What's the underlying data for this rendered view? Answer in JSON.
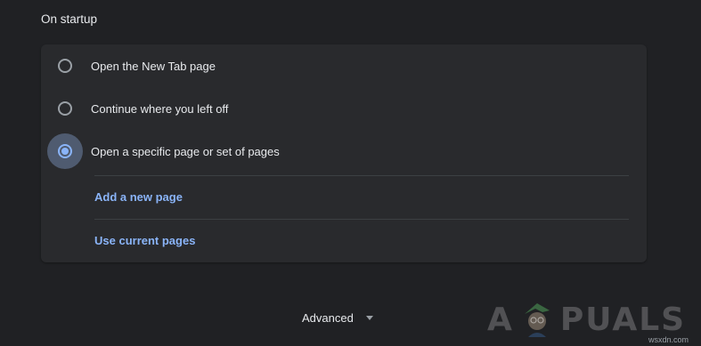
{
  "section": {
    "title": "On startup"
  },
  "startup_options": [
    {
      "label": "Open the New Tab page",
      "checked": false
    },
    {
      "label": "Continue where you left off",
      "checked": false
    },
    {
      "label": "Open a specific page or set of pages",
      "checked": true
    }
  ],
  "links": {
    "add_new_page": "Add a new page",
    "use_current_pages": "Use current pages"
  },
  "advanced": {
    "label": "Advanced"
  },
  "watermark": {
    "brand_left": "A",
    "brand_right": "PUALS",
    "domain": "wsxdn.com"
  },
  "colors": {
    "background": "#202124",
    "card": "#292a2d",
    "accent": "#8ab4f8",
    "text": "#e8eaed",
    "radio_border": "#9aa0a6"
  }
}
